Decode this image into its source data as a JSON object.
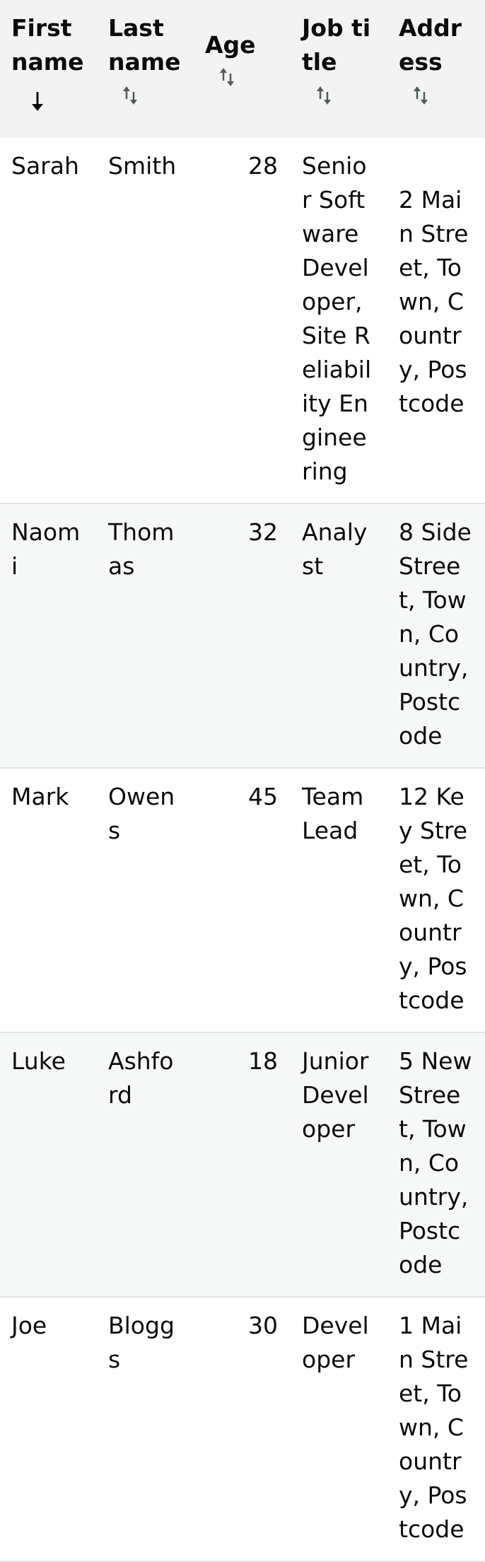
{
  "table": {
    "headers": [
      {
        "label": "First name",
        "sort": "descending"
      },
      {
        "label": "Last name",
        "sort": "none"
      },
      {
        "label": "Age",
        "sort": "none"
      },
      {
        "label": "Job title",
        "sort": "none"
      },
      {
        "label": "Address",
        "sort": "none"
      }
    ],
    "rows": [
      {
        "first": "Sarah",
        "last": "Smith",
        "age": "28",
        "job": "Senior Software Developer, Site Reliability Engineering",
        "address": "2 Main Street, Town, Country, Postcode"
      },
      {
        "first": "Naomi",
        "last": "Thomas",
        "age": "32",
        "job": "Analyst",
        "address": "8 Side Street, Town, Country, Postcode"
      },
      {
        "first": "Mark",
        "last": "Owens",
        "age": "45",
        "job": "Team Lead",
        "address": "12 Key Street, Town, Country, Postcode"
      },
      {
        "first": "Luke",
        "last": "Ashford",
        "age": "18",
        "job": "Junior Developer",
        "address": "5 New Street, Town, Country, Postcode"
      },
      {
        "first": "Joe",
        "last": "Bloggs",
        "age": "30",
        "job": "Developer",
        "address": "1 Main Street, Town, Country, Postcode"
      }
    ]
  },
  "icons": {
    "sort_descending": "arrow-down-icon",
    "sort_none": "sort-up-down-icon"
  },
  "colors": {
    "header_bg": "#f3f3f3",
    "stripe_bg": "#f6f8f7",
    "row_border": "#e1e4e6",
    "text": "#0b0c0c",
    "sort_icon": "#505a5f"
  }
}
